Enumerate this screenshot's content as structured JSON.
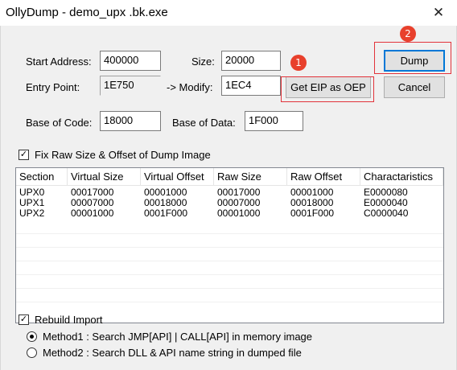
{
  "window": {
    "title": "OllyDump - demo_upx .bk.exe",
    "close_glyph": "✕"
  },
  "fields": {
    "start_address": {
      "label": "Start Address:",
      "value": "400000"
    },
    "size": {
      "label": "Size:",
      "value": "20000"
    },
    "entry_point": {
      "label": "Entry Point:",
      "value": "1E750"
    },
    "modify": {
      "label": "-> Modify:",
      "value": "1EC4"
    },
    "base_of_code": {
      "label": "Base of Code:",
      "value": "18000"
    },
    "base_of_data": {
      "label": "Base of Data:",
      "value": "1F000"
    }
  },
  "buttons": {
    "get_eip": "Get EIP as OEP",
    "dump": "Dump",
    "cancel": "Cancel"
  },
  "annotations": {
    "badge1": "1",
    "badge2": "2",
    "accent": "#e2333a"
  },
  "fix_raw": {
    "label": "Fix Raw Size & Offset of Dump Image",
    "checked": true,
    "mark": "✓"
  },
  "sections": {
    "columns": [
      "Section",
      "Virtual Size",
      "Virtual Offset",
      "Raw Size",
      "Raw Offset",
      "Charactaristics"
    ],
    "rows": [
      [
        "UPX0",
        "00017000",
        "00001000",
        "00017000",
        "00001000",
        "E0000080"
      ],
      [
        "UPX1",
        "00007000",
        "00018000",
        "00007000",
        "00018000",
        "E0000040"
      ],
      [
        "UPX2",
        "00001000",
        "0001F000",
        "00001000",
        "0001F000",
        "C0000040"
      ]
    ]
  },
  "rebuild_import": {
    "label": "Rebuild Import",
    "checked": true,
    "mark": "✓"
  },
  "methods": {
    "method1": {
      "label": "Method1 : Search JMP[API] | CALL[API] in memory image",
      "selected": true
    },
    "method2": {
      "label": "Method2 : Search DLL & API name string in dumped file",
      "selected": false
    }
  }
}
